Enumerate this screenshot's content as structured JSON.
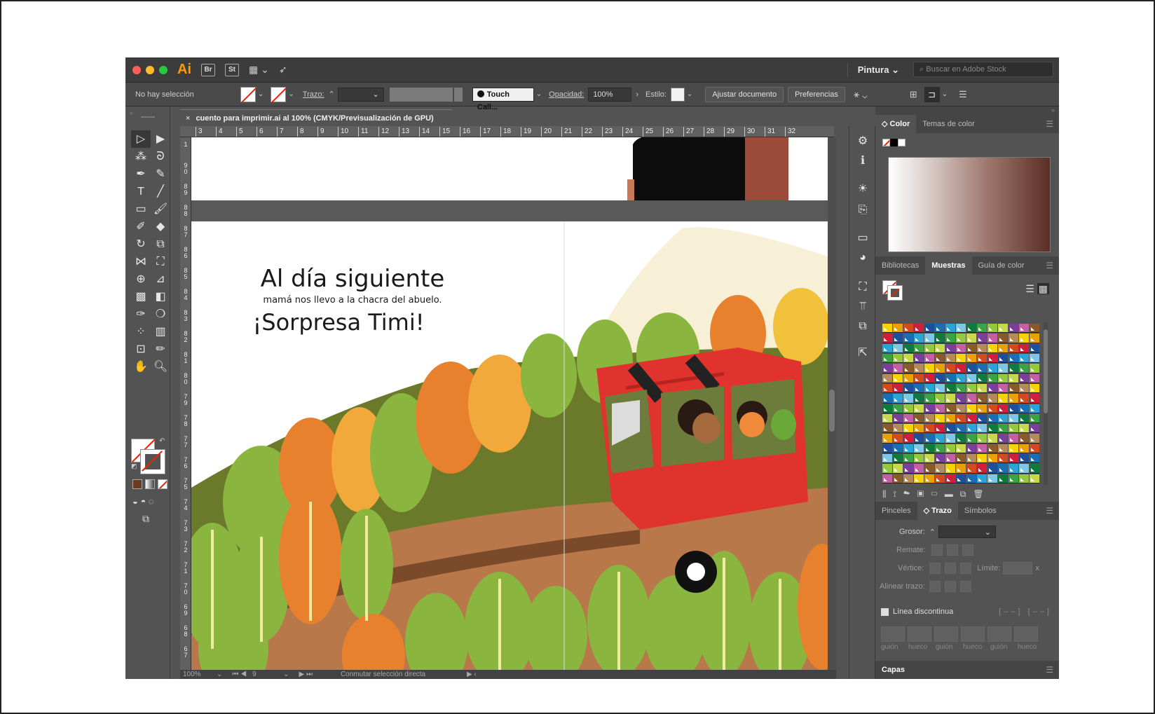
{
  "titlebar": {
    "app_logo": "Ai",
    "bridge": "Br",
    "stock": "St",
    "workspace": "Pintura",
    "stock_search_placeholder": "Buscar en Adobe Stock"
  },
  "controlbar": {
    "selection": "No hay selección",
    "stroke_label": "Trazo:",
    "brush_name": "Touch Call...",
    "opacity_label": "Opacidad:",
    "opacity_value": "100%",
    "style_label": "Estilo:",
    "adjust_doc": "Ajustar documento",
    "preferences": "Preferencias"
  },
  "document": {
    "tab_title": "cuento  para imprimir.ai al 100% (CMYK/Previsualización de GPU)",
    "ruler_h": [
      "3",
      "4",
      "5",
      "6",
      "7",
      "8",
      "9",
      "10",
      "11",
      "12",
      "13",
      "14",
      "15",
      "16",
      "17",
      "18",
      "19",
      "20",
      "21",
      "22",
      "23",
      "24",
      "25",
      "26",
      "27",
      "28",
      "29",
      "30",
      "31",
      "32"
    ],
    "ruler_v": [
      "1",
      "9 0",
      "8 9",
      "8 8",
      "8 7",
      "8 6",
      "8 5",
      "8 4",
      "8 3",
      "8 2",
      "8 1",
      "8 0",
      "7 9",
      "7 8",
      "7 7",
      "7 6",
      "7 5",
      "7 4",
      "7 3",
      "7 2",
      "7 1",
      "7 0",
      "6 9",
      "6 8",
      "6 7"
    ],
    "text_heading": "Al día siguiente",
    "text_line": "mamá nos llevo  a  la chacra del abuelo.",
    "text_exclaim": "¡Sorpresa Timi!"
  },
  "statusbar": {
    "zoom": "100%",
    "page": "9",
    "tool_hint": "Conmutar selección directa"
  },
  "color_panel": {
    "tab_color": "Color",
    "tab_themes": "Temas de color"
  },
  "swatches_panel": {
    "tab_libraries": "Bibliotecas",
    "tab_swatches": "Muestras",
    "tab_guide": "Guía de color",
    "colors": [
      "#f5d200",
      "#e8a100",
      "#d44a1f",
      "#cf1f3a",
      "#1d4f9a",
      "#1a6fb4",
      "#2aa3d6",
      "#7dc6e6",
      "#0e7a3e",
      "#3aa345",
      "#94c93d",
      "#c6d94a",
      "#7a3f9b",
      "#c45ea5",
      "#8b5a2b",
      "#b58a5a"
    ]
  },
  "stroke_panel": {
    "tab_brushes": "Pinceles",
    "tab_stroke": "Trazo",
    "tab_symbols": "Símbolos",
    "weight_label": "Grosor:",
    "cap_label": "Remate:",
    "corner_label": "Vértice:",
    "limit_label": "Límite:",
    "limit_suffix": "x",
    "align_label": "Alinear trazo:",
    "dashed_label": "Línea discontinua",
    "dash_labels": [
      "guión",
      "hueco",
      "guión",
      "hueco",
      "guión",
      "hueco"
    ]
  },
  "layers_panel": {
    "title": "Capas"
  },
  "colors": {
    "accent": "#ff9a00",
    "car_red": "#e0332d",
    "tree_green": "#8ab640",
    "tree_orange": "#e8812e"
  }
}
